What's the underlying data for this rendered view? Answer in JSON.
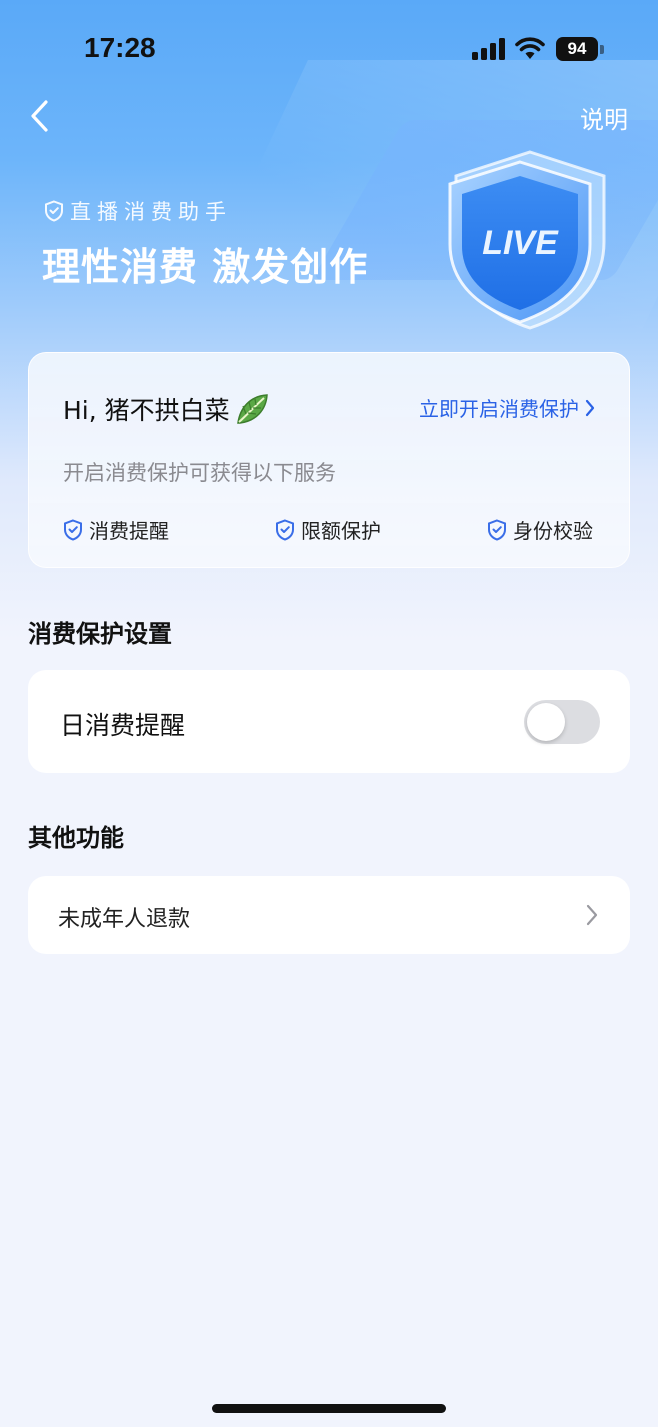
{
  "status_bar": {
    "time": "17:28",
    "battery": "94",
    "icons": [
      "signal-icon",
      "wifi-icon",
      "battery-icon"
    ]
  },
  "nav": {
    "back_icon": "chevron-left-icon",
    "explain_label": "说明"
  },
  "hero": {
    "subtitle": "直播消费助手",
    "title": "理性消费 激发创作",
    "illustration_text": "LIVE"
  },
  "protect_card": {
    "greeting": "Hi, 猪不拱白菜",
    "greeting_emoji": "leaf-icon",
    "open_link": "立即开启消费保护",
    "description": "开启消费保护可获得以下服务",
    "services": [
      {
        "label": "消费提醒",
        "icon": "shield-check-icon"
      },
      {
        "label": "限额保护",
        "icon": "shield-check-icon"
      },
      {
        "label": "身份校验",
        "icon": "shield-check-icon"
      }
    ]
  },
  "settings_section": {
    "title": "消费保护设置",
    "items": [
      {
        "label": "日消费提醒",
        "toggle_on": false
      }
    ]
  },
  "other_section": {
    "title": "其他功能",
    "items": [
      {
        "label": "未成年人退款",
        "icon": "chevron-right-icon"
      }
    ]
  },
  "colors": {
    "accent": "#2a62e6",
    "hero_top": "#5aa9f8",
    "background": "#f1f4fd",
    "toggle_off": "#dcdde1"
  }
}
